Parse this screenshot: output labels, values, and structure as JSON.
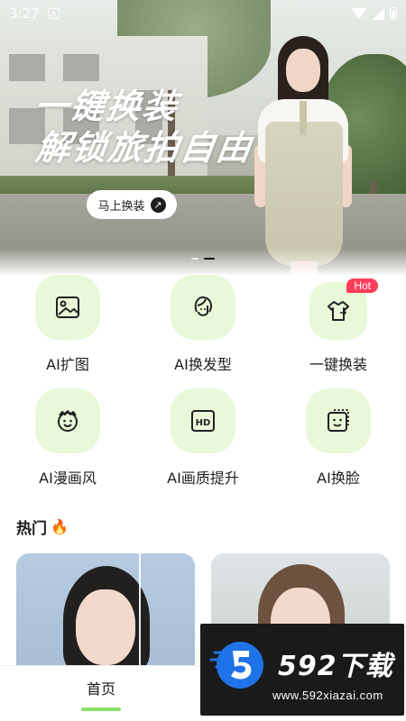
{
  "status_bar": {
    "time": "3:27",
    "notification": "A"
  },
  "banner": {
    "headline_line1": "一键换装",
    "headline_line2": "解锁旅拍自由",
    "cta_label": "马上换装",
    "cta_icon": "arrow-up-right-icon",
    "dots": 2,
    "active_dot": 1
  },
  "features": [
    {
      "label": "AI扩图",
      "icon": "image-expand-icon"
    },
    {
      "label": "AI换发型",
      "icon": "hairstyle-icon"
    },
    {
      "label": "一键换装",
      "icon": "outfit-swap-icon",
      "badge": "Hot"
    },
    {
      "label": "AI漫画风",
      "icon": "comic-face-icon"
    },
    {
      "label": "AI画质提升",
      "icon": "hd-icon"
    },
    {
      "label": "AI换脸",
      "icon": "face-swap-icon"
    }
  ],
  "hot_section": {
    "title": "热门",
    "icon": "fire-icon"
  },
  "bottom_nav": {
    "home_label": "首页"
  },
  "watermark": {
    "brand": "592下载",
    "url": "www.592xiazai.com"
  },
  "colors": {
    "accent_green": "#8be36c",
    "bubble_green": "#e8f8d8",
    "hot_badge": "#ff3c5a"
  }
}
